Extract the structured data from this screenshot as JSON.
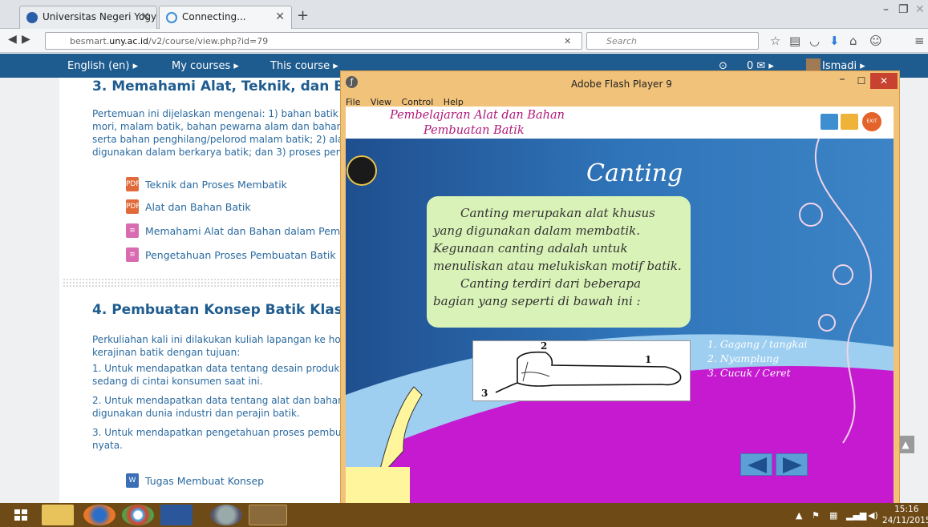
{
  "browser": {
    "tabs": [
      {
        "label": "Universitas Negeri Yogyak...",
        "active": false
      },
      {
        "label": "Connecting...",
        "active": true
      }
    ],
    "url_prefix": "besmart.",
    "url_domain": "uny.ac.id",
    "url_path": "/v2/course/view.php?id=79",
    "search_placeholder": "Search"
  },
  "moodle_nav": {
    "language": "English (en) ▸",
    "my_courses": "My courses ▸",
    "this_course": "This course ▸",
    "messages": "0 ✉ ▸",
    "user": "Ismadi ▸"
  },
  "section3": {
    "title": "3. Memahami Alat, Teknik, dan B",
    "lines": [
      "Pertemuan ini dijelaskan mengenai: 1) bahan batik y",
      "mori, malam batik, bahan pewarna alam dan bahan",
      "serta bahan penghilang/pelorod malam batik; 2) ala",
      "digunakan dalam berkarya batik; dan 3) proses pem"
    ],
    "resources": [
      "Teknik dan Proses Membatik",
      "Alat dan Bahan Batik",
      "Memahami Alat dan Bahan dalam Pembu",
      "Pengetahuan Proses Pembuatan Batik"
    ]
  },
  "section4": {
    "title": "4. Pembuatan Konsep Batik Klas",
    "intro": [
      "Perkuliahan kali ini dilakukan kuliah lapangan ke hom",
      "kerajinan batik dengan tujuan:"
    ],
    "point1": [
      "1. Untuk mendapatkan data tentang desain produk",
      "sedang di cintai konsumen saat ini."
    ],
    "point2": [
      "2. Untuk mendapatkan data tentang alat dan bahan",
      "digunakan dunia industri dan perajin batik."
    ],
    "point3": [
      "3. Untuk mendapatkan pengetahuan proses pembu",
      "nyata."
    ],
    "assignment": "Tugas Membuat Konsep"
  },
  "flash": {
    "window_title": "Adobe Flash Player 9",
    "menu": [
      "File",
      "View",
      "Control",
      "Help"
    ],
    "header_line1": "Pembelajaran Alat dan Bahan",
    "header_line2": "Pembuatan Batik",
    "exit_label": "EXIT",
    "slide_title": "Canting",
    "para1": "Canting merupakan alat khusus yang digunakan dalam membatik. Kegunaan canting adalah  untuk menuliskan atau melukiskan motif batik.",
    "para2": "Canting terdiri dari beberapa bagian yang seperti di bawah ini :",
    "part_numbers": [
      "1",
      "2",
      "3"
    ],
    "parts": [
      "1. Gagang / tangkai",
      "2. Nyamplung",
      "3. Cucuk  / Ceret"
    ]
  },
  "taskbar": {
    "time": "15:16",
    "date": "24/11/2015"
  },
  "colors": {
    "moodle_blue": "#1e5b8f",
    "stage_blue": "#2f74b8",
    "stage_magenta": "#c61ad0",
    "accent_text": "#b0197a"
  }
}
